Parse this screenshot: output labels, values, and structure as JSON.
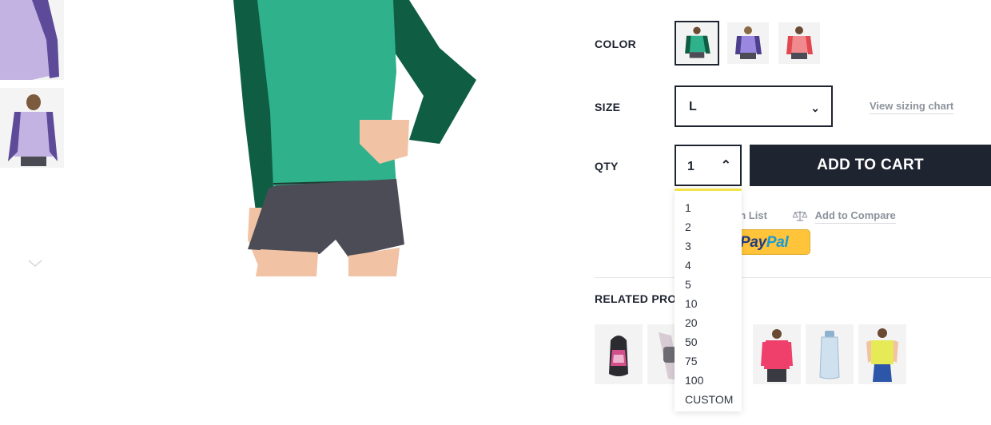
{
  "options": {
    "color_label": "COLOR",
    "size_label": "SIZE",
    "qty_label": "QTY",
    "size_value": "L",
    "size_chevron": "⌄",
    "sizing_chart_link": "View sizing chart",
    "qty_value": "1",
    "qty_chevron": "⌃",
    "add_to_cart": "ADD TO CART",
    "color_swatches": [
      {
        "name": "green",
        "color": "#1f7a55",
        "selected": true
      },
      {
        "name": "purple",
        "color": "#7b68c8",
        "selected": false
      },
      {
        "name": "red",
        "color": "#e2484f",
        "selected": false
      }
    ]
  },
  "links": {
    "wish_list_partial": "sh List",
    "add_to_compare": "Add to Compare"
  },
  "paypal": {
    "pay": "Pay",
    "pal": "Pal"
  },
  "related": {
    "title": "RELATED PRODUCTS",
    "items": [
      "backpack-icon",
      "watch-icon",
      "hoodie-pink-icon",
      "water-bottle-icon",
      "yellow-tee-icon"
    ]
  },
  "qty_dropdown": {
    "options": [
      "1",
      "2",
      "3",
      "4",
      "5",
      "10",
      "20",
      "50",
      "75",
      "100",
      "CUSTOM"
    ]
  },
  "colors": {
    "primary_dark": "#1f2431",
    "paypal_yellow": "#ffc439",
    "dropdown_accent": "#f4e24a",
    "muted_link": "#8d939c"
  }
}
